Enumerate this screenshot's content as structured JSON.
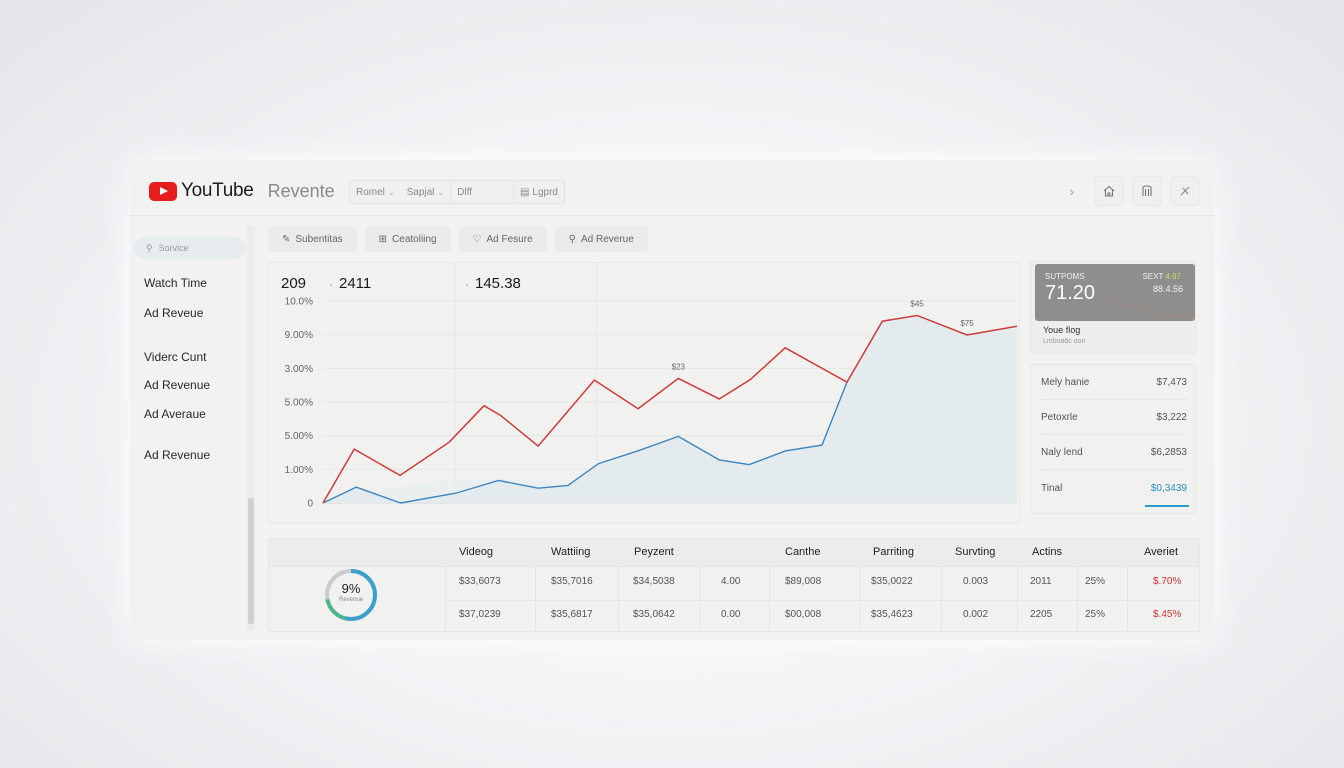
{
  "header": {
    "brand": "YouTube",
    "subtitle": "Revente",
    "controls": [
      {
        "label": "Romel",
        "has_dropdown": true
      },
      {
        "label": "Sapjal",
        "has_dropdown": true
      },
      {
        "label": "Dlff",
        "has_dropdown": false
      }
    ],
    "legend_label": "Lgprd",
    "right_icons": [
      "chevron-right-icon",
      "home-icon",
      "bookmark-icon",
      "close-icon"
    ]
  },
  "sidebar": {
    "search_placeholder": "Sorvice",
    "items": [
      {
        "label": "Watch Time"
      },
      {
        "label": "Ad Reveue"
      },
      {
        "label": "Viderc Cunt"
      },
      {
        "label": "Ad Revenue"
      },
      {
        "label": "Ad Averaue"
      },
      {
        "label": "Ad Revenue"
      }
    ]
  },
  "tabs": [
    {
      "label": "Subentitas",
      "icon": "pin-icon"
    },
    {
      "label": "Ceatoliing",
      "icon": "grid-icon"
    },
    {
      "label": "Ad Fesure",
      "icon": "shield-icon"
    },
    {
      "label": "Ad Reverue",
      "icon": "search-icon"
    }
  ],
  "stats": [
    {
      "value": "209"
    },
    {
      "value": "2411"
    },
    {
      "value": "145.38"
    }
  ],
  "chart_data": {
    "type": "line",
    "title": "",
    "xlabel": "",
    "ylabel": "",
    "y_tick_labels": [
      "0",
      "1.00%",
      "5.00%",
      "5.00%",
      "3.00%",
      "9.00%",
      "10.0%"
    ],
    "ylim": [
      0,
      6
    ],
    "grid": true,
    "x": [
      0,
      1,
      2,
      3,
      4,
      5,
      6,
      7,
      8,
      9,
      10,
      11,
      12,
      13,
      14,
      15,
      16,
      17
    ],
    "series": [
      {
        "name": "revenue",
        "color": "#d03a3a",
        "values": [
          0,
          1.6,
          0.82,
          1.81,
          2.89,
          2.6,
          1.69,
          3.65,
          2.8,
          3.7,
          3.09,
          3.67,
          4.61,
          3.59,
          5.4,
          5.57,
          4.99,
          5.25
        ]
      },
      {
        "name": "views",
        "color": "#3a86c0",
        "area": true,
        "values": [
          0,
          0.47,
          0,
          0.29,
          0.67,
          0.44,
          0.52,
          1.17,
          1.55,
          1.98,
          1.28,
          1.14,
          1.55,
          1.72,
          3.59,
          5.4,
          5.57,
          4.99,
          5.25
        ]
      }
    ],
    "annotations": [
      {
        "text": "$23",
        "series": "revenue",
        "index": 9
      },
      {
        "text": "$45",
        "series": "revenue",
        "index": 15
      },
      {
        "text": "$75",
        "series": "revenue",
        "index": 16
      }
    ],
    "secondary_label": "10.0%"
  },
  "promo": {
    "label": "SUTPOMS",
    "value": "71.20",
    "right_label": "SEXT",
    "right_delta": "4.97",
    "right_value": "88.4.56",
    "title": "Youe flog",
    "subtitle": "Lmboa6c oon",
    "accent": "#c7e35a"
  },
  "summary": {
    "rows": [
      {
        "label": "Mely hanie",
        "value": "$7,473"
      },
      {
        "label": "Petoxrle",
        "value": "$3,222"
      },
      {
        "label": "Naly lend",
        "value": "$6,2853"
      },
      {
        "label": "Tinal",
        "value": "$0,3439"
      }
    ],
    "total_color": "#2c8fc7"
  },
  "table": {
    "headers": [
      "Videog",
      "Wattiing",
      "Peyzent",
      "",
      "Canthe",
      "Parriting",
      "Survting",
      "Actins",
      "",
      "Averiet"
    ],
    "donut": {
      "value": "9%",
      "label": "Revenue",
      "fraction": 0.72
    },
    "rows": [
      [
        "$33,6073",
        "$35,7016",
        "$34,5038",
        "4.00",
        "$89,008",
        "$35,0022",
        "0.003",
        "2011",
        "25%",
        "$.70%"
      ],
      [
        "$37,0239",
        "$35,6817",
        "$35,0642",
        "0.00",
        "$00,008",
        "$35,4623",
        "0.002",
        "2205",
        "25%",
        "$.45%"
      ]
    ],
    "negative_color": "#d0333a"
  }
}
